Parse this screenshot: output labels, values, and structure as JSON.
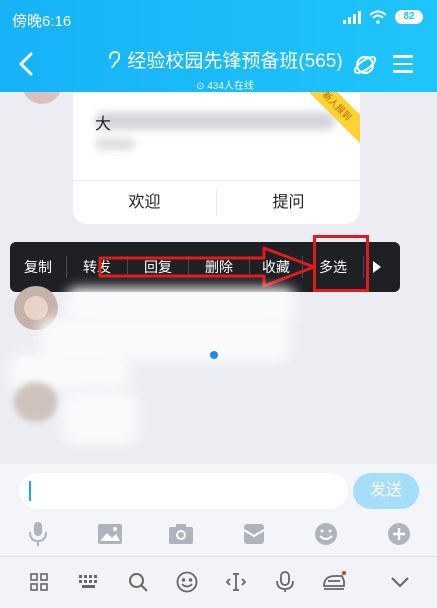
{
  "status_bar": {
    "time": "傍晚6:16",
    "battery": "82"
  },
  "header": {
    "title": "经验校园先锋预备班(565)",
    "online": "434人在线"
  },
  "card": {
    "lead_text": "大",
    "ribbon": "新人报到",
    "buttons": [
      "欢迎",
      "提问"
    ]
  },
  "context_menu": {
    "items": [
      "复制",
      "转发",
      "回复",
      "删除",
      "收藏",
      "多选"
    ]
  },
  "input": {
    "send_label": "发送"
  },
  "colors": {
    "accent": "#1ec5fb",
    "highlight": "#e11b1b"
  }
}
